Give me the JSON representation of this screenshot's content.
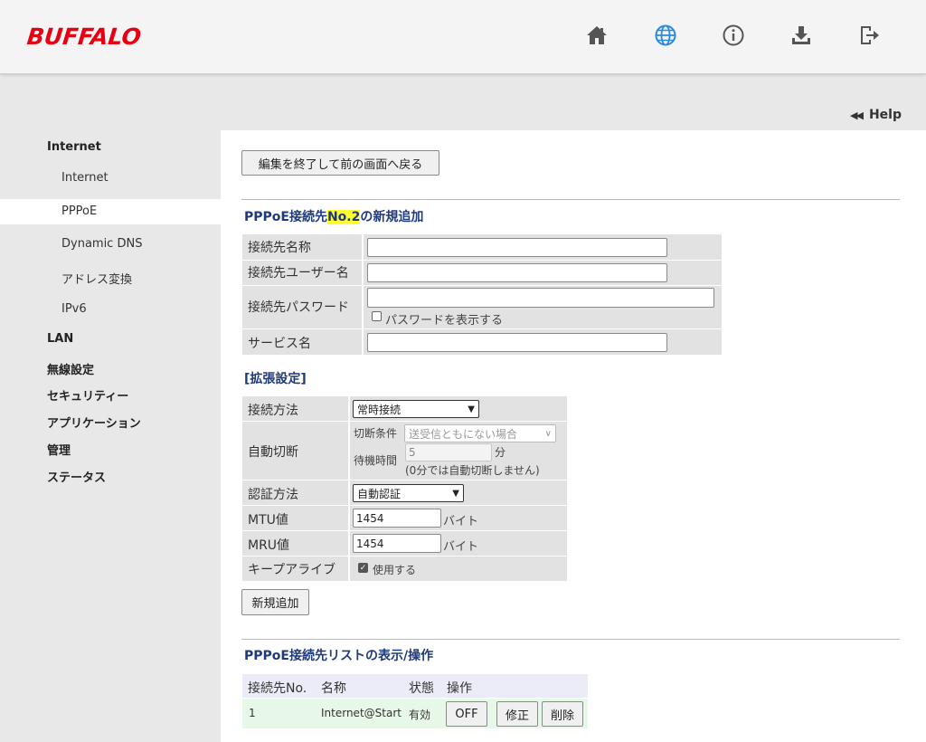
{
  "header": {
    "logo": "BUFFALO",
    "icons": [
      "home-icon",
      "globe-icon",
      "info-icon",
      "download-icon",
      "logout-icon"
    ],
    "active_icon_color": "#2a8ae0",
    "icon_color": "#555555"
  },
  "help": {
    "label": "Help"
  },
  "sidebar": {
    "internet": "Internet",
    "items": [
      "Internet",
      "PPPoE",
      "Dynamic DNS",
      "アドレス変換",
      "IPv6"
    ],
    "categories": [
      "LAN",
      "無線設定",
      "セキュリティー",
      "アプリケーション",
      "管理",
      "ステータス"
    ]
  },
  "main": {
    "back_button": "編集を終了して前の画面へ戻る",
    "title_prefix": "PPPoE接続先",
    "title_highlight": "No.2",
    "title_suffix": "の新規追加",
    "fields": {
      "name_label": "接続先名称",
      "user_label": "接続先ユーザー名",
      "password_label": "接続先パスワード",
      "show_password_label": "パスワードを表示する",
      "service_label": "サービス名"
    },
    "extended_title": "[拡張設定]",
    "ext": {
      "connect_method_label": "接続方法",
      "connect_method_value": "常時接続",
      "auto_disconnect_label": "自動切断",
      "condition_label": "切断条件",
      "condition_value": "送受信ともにない場合",
      "wait_label": "待機時間",
      "wait_value": "5",
      "wait_unit": "分",
      "wait_note": "(0分では自動切断しません)",
      "auth_label": "認証方法",
      "auth_value": "自動認証",
      "mtu_label": "MTU値",
      "mtu_value": "1454",
      "mtu_unit": "バイト",
      "mru_label": "MRU値",
      "mru_value": "1454",
      "mru_unit": "バイト",
      "keepalive_label": "キープアライブ",
      "keepalive_option": "使用する"
    },
    "add_button": "新規追加",
    "list_title": "PPPoE接続先リストの表示/操作",
    "list_headers": [
      "接続先No.",
      "名称",
      "状態",
      "操作"
    ],
    "list_row": {
      "no": "1",
      "name": "Internet@Start",
      "status": "有効",
      "off": "OFF",
      "edit": "修正",
      "delete": "削除"
    }
  }
}
